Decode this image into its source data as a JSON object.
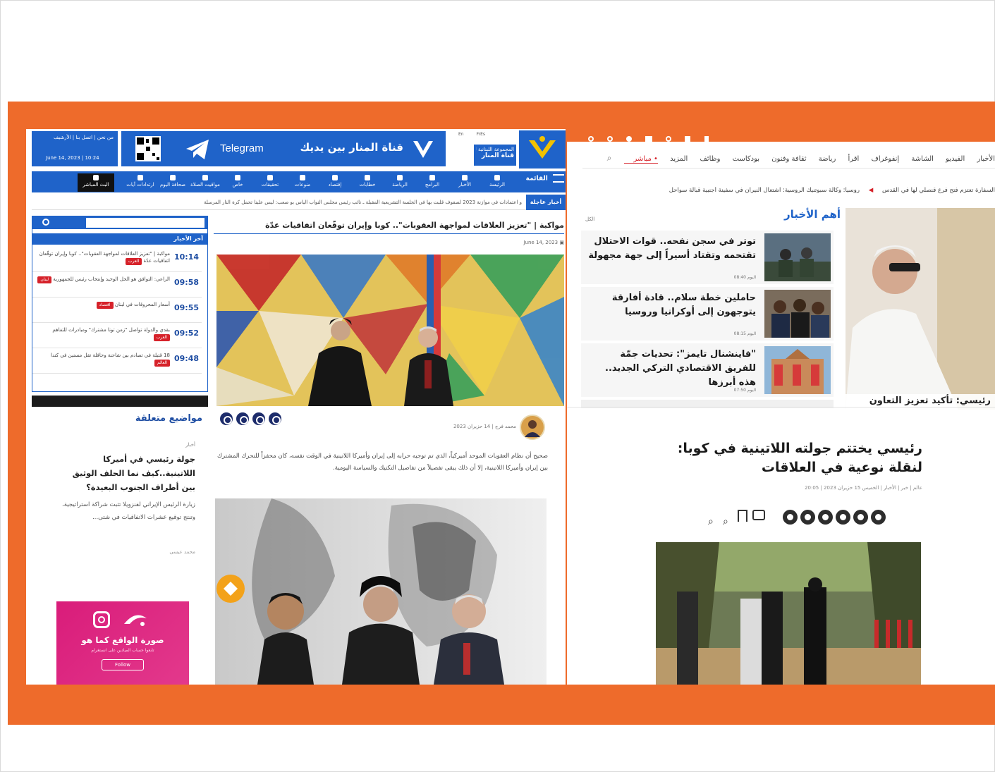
{
  "left_site": {
    "logo_name": "almanar-logo",
    "header": {
      "org_name": "المجموعة اللبنانية للإعلام",
      "channel_name": "قناة المنار",
      "banner_text": "قناة المنار بين يديك",
      "telegram_label": "Telegram",
      "top_links": [
        "من نحن",
        "اتصل بنا",
        "الأرشيف"
      ],
      "date_label": "June 14, 2023 | 10:24"
    },
    "nav": {
      "menu_label": "القائمة",
      "items": [
        "الرئيسة",
        "الأخبار",
        "البرامج",
        "الرياضة",
        "خطابات",
        "إقتصاد",
        "منوعات",
        "تحقيقات",
        "خاص",
        "مواقيت الصلاة",
        "صحافة اليوم",
        "ارتدادات آيات",
        "البث المباشر"
      ]
    },
    "ticker": {
      "label": "أخبار عاجلة",
      "text": "و اعتمادات في موازنة 2023 لصفوف قلبت بها في الجلسة التشريعية المقبلة ـ نائب رئيس مجلس النواب الياس بو صعب: ليس علينا تحمل كرة النار المرسلة"
    },
    "article": {
      "title": "مواكبة | \"تعزيز العلاقات لمواجهة العقوبات\".. كوبا وإيران توقّعان اتفاقيات عدّة",
      "meta_date": "June 14, 2023",
      "author_line": "محمد فرج | 14 حزيران 2023",
      "body": "صحيح أن نظام العقوبات الموحد أميركياً، الذي تم توجيه حرابه إلى إيران وأميركا اللاتينية في الوقت نفسه، كان محفزاً للتحرك المشترك بين إيران وأميركا اللاتينية، إلا أن ذلك يبقى تفصيلاً من تفاصيل التكتيك والسياسة اليومية."
    },
    "sidebar": {
      "search_placeholder": "",
      "latest_title": "آخر الأخبار",
      "latest": [
        {
          "time": "10:14",
          "text": "مواكبة | \"تعزيز العلاقات لمواجهة العقوبات\".. كوبا وإيران توقّعان اتفاقيات عدّة",
          "tag": "العرب"
        },
        {
          "time": "09:58",
          "text": "الراعي: التوافق هو الحل الوحيد وإنتخاب رئيس للجمهورية",
          "tag": "لبنان"
        },
        {
          "time": "09:55",
          "text": "أسعار المحروقات في لبنان",
          "tag": "اقتصاد"
        },
        {
          "time": "09:52",
          "text": "بقدي والدولة تواصل \"زمن تونا مشترك\" ومبادرات للتفاهم",
          "tag": "العرب"
        },
        {
          "time": "09:48",
          "text": "18 قتيلة في تصادم بين شاحنة وحافلة تقل مسنين في كندا",
          "tag": "العالم"
        }
      ]
    },
    "related": {
      "title": "مواضيع متعلقة",
      "category": "أخبار",
      "headline": "جولة رئيسي في أميركا اللاتينية..كيف نما الحلف الوثيق بين أطراف الجنوب البعيدة؟",
      "excerpt": "زيارة الرئيس الإيراني لفنزويلا تثبت شراكة استراتيجية، وتنتج توقيع عشرات الاتفاقيات في شتى...",
      "author": "محمد عيسى"
    },
    "ad": {
      "text": "صورة الواقع كما هو",
      "sub": "تابعوا حساب الميادين على انستغرام",
      "button": "Follow"
    },
    "colors": {
      "primary": "#1f63c9",
      "nav": "#1f63c9",
      "accent": "#d6222a"
    }
  },
  "right_site": {
    "nav": [
      "الأخبار",
      "الفيديو",
      "الشاشة",
      "إنفوغراف",
      "اقرأ",
      "رياضة",
      "ثقافة وفنون",
      "بودكاست",
      "وظائف",
      "المزيد"
    ],
    "live_label": "مباشر",
    "ticker": [
      "السفارة تعتزم فتح فرع قنصلي لها في القدس",
      "روسيا: وكالة سبوتنيك الروسية: اشتعال النيران في سفينة أجنبية قبالة سواحل"
    ],
    "top_news_title": "أهم الأخبار",
    "all_label": "الكل",
    "headlines": [
      {
        "title": "توتر في سجن نفحه.. قوات الاحتلال تقتحمه وتقتاد أسيراً إلى جهة مجهولة",
        "date": "اليوم 08:40"
      },
      {
        "title": "حاملين خطة سلام.. قادة أفارقة يتوجهون إلى أوكرانيا وروسيا",
        "date": "اليوم 08:15"
      },
      {
        "title": "\"فاينشنال تايمز\": تحديات جمّة للفريق الاقتصادي التركي الجديد.. هذه أبرزها",
        "date": "اليوم 07:50"
      }
    ],
    "hero_caption": "رئيسي: تأكيد تعزيز التعاون",
    "article": {
      "title": "رئيسي يختتم جولته اللاتينية في كوبا: لنقلة نوعية في العلاقات",
      "meta": "عالم | خبر | الأخبار | الخميس 15 حزيران 2023 | 20:05"
    },
    "colors": {
      "live": "#d6222a",
      "title_blue": "#1f63c9"
    }
  }
}
